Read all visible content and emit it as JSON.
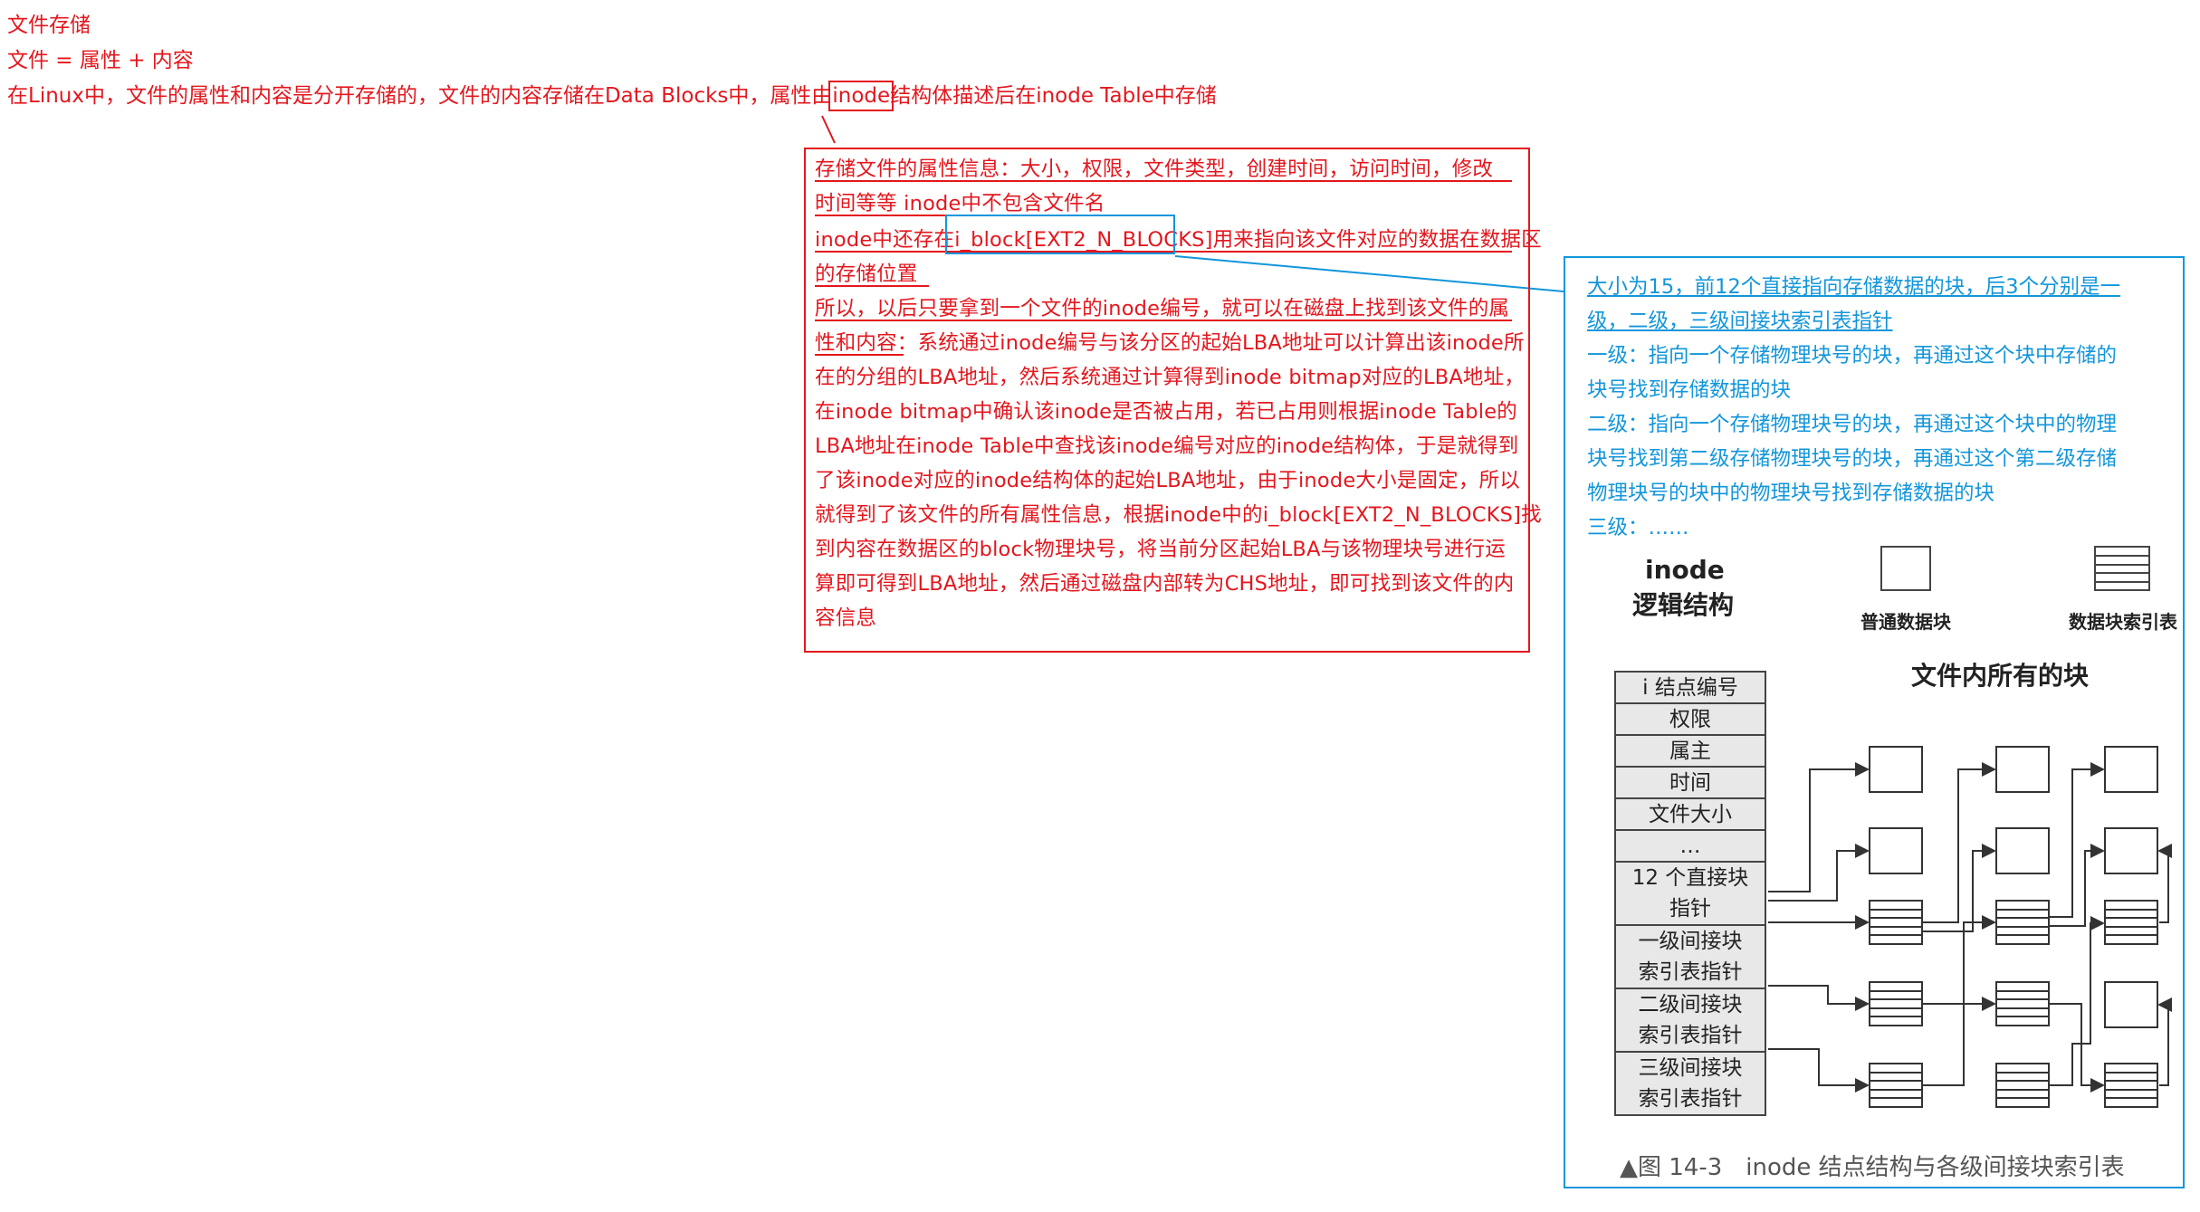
{
  "header": {
    "title": "文件存储",
    "formula": "文件 = 属性 + 内容",
    "intro_part1": "在Linux中，文件的属性和内容是分开存储的，文件的内容存储在Data Blocks中，属性由",
    "intro_highlight": "inode",
    "intro_part2": "结构体描述后在inode Table中存储"
  },
  "red_note": {
    "lines": [
      "存储文件的属性信息：大小，权限，文件类型，创建时间，访问时间，修改",
      "时间等等   inode中不包含文件名",
      "inode中还存在i_block[EXT2_N_BLOCKS]用来指向该文件对应的数据在数据区",
      "的存储位置",
      "所以，以后只要拿到一个文件的inode编号，就可以在磁盘上找到该文件的属",
      "性和内容：系统通过inode编号与该分区的起始LBA地址可以计算出该inode所",
      "在的分组的LBA地址，然后系统通过计算得到inode bitmap对应的LBA地址，",
      "在inode bitmap中确认该inode是否被占用，若已占用则根据inode Table的",
      "LBA地址在inode Table中查找该inode编号对应的inode结构体，于是就得到",
      "了该inode对应的inode结构体的起始LBA地址，由于inode大小是固定，所以",
      "就得到了该文件的所有属性信息，根据inode中的i_block[EXT2_N_BLOCKS]找",
      "到内容在数据区的block物理块号，将当前分区起始LBA与该物理块号进行运",
      "算即可得到LBA地址，然后通过磁盘内部转为CHS地址，即可找到该文件的内",
      "容信息"
    ]
  },
  "blue_note": {
    "lines": [
      "大小为15，前12个直接指向存储数据的块，后3个分别是一",
      "级，二级，三级间接块索引表指针",
      "一级：指向一个存储物理块号的块，再通过这个块中存储的",
      "块号找到存储数据的块",
      "二级：指向一个存储物理块号的块，再通过这个块中的物理",
      "块号找到第二级存储物理块号的块，再通过这个第二级存储",
      "物理块号的块中的物理块号找到存储数据的块",
      "三级：……"
    ]
  },
  "figure": {
    "inode_title_1": "inode",
    "inode_title_2": "逻辑结构",
    "legend_data": "普通数据块",
    "legend_index": "数据块索引表",
    "all_blocks": "文件内所有的块",
    "cells": [
      "i 结点编号",
      "权限",
      "属主",
      "时间",
      "文件大小",
      "…",
      "12 个直接块",
      "指针",
      "一级间接块",
      "索引表指针",
      "二级间接块",
      "索引表指针",
      "三级间接块",
      "索引表指针"
    ],
    "caption": "▲图 14-3　inode 结点结构与各级间接块索引表"
  }
}
